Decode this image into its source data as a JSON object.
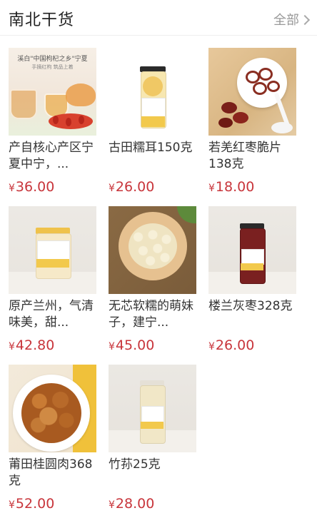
{
  "header": {
    "title": "南北干货",
    "more": "全部"
  },
  "products": [
    {
      "name": "产自核心产区宁夏中宁，...",
      "currency": "¥",
      "price": "36.00",
      "image": "goji-tea"
    },
    {
      "name": "古田糯耳150克",
      "currency": "¥",
      "price": "26.00",
      "image": "jar-white-fungus"
    },
    {
      "name": "若羌红枣脆片138克",
      "currency": "¥",
      "price": "18.00",
      "image": "date-chips-bowl"
    },
    {
      "name": "原产兰州，气清味美，甜...",
      "currency": "¥",
      "price": "42.80",
      "image": "jar-lily-bulb"
    },
    {
      "name": "无芯软糯的萌妹子，建宁...",
      "currency": "¥",
      "price": "45.00",
      "image": "lotus-seeds-plate"
    },
    {
      "name": "楼兰灰枣328克",
      "currency": "¥",
      "price": "26.00",
      "image": "jar-red-dates"
    },
    {
      "name": "莆田桂圆肉368克",
      "currency": "¥",
      "price": "52.00",
      "image": "longan-bowl"
    },
    {
      "name": "竹荪25克",
      "currency": "¥",
      "price": "28.00",
      "image": "jar-bamboo-fungus"
    }
  ],
  "image_text": {
    "goji_banner": "溪白\"中国枸杞之乡\"宁夏",
    "goji_sub": "手摘红枸  筑品上着"
  },
  "colors": {
    "price": "#c8353b",
    "accent_yellow": "#f2c94c"
  }
}
